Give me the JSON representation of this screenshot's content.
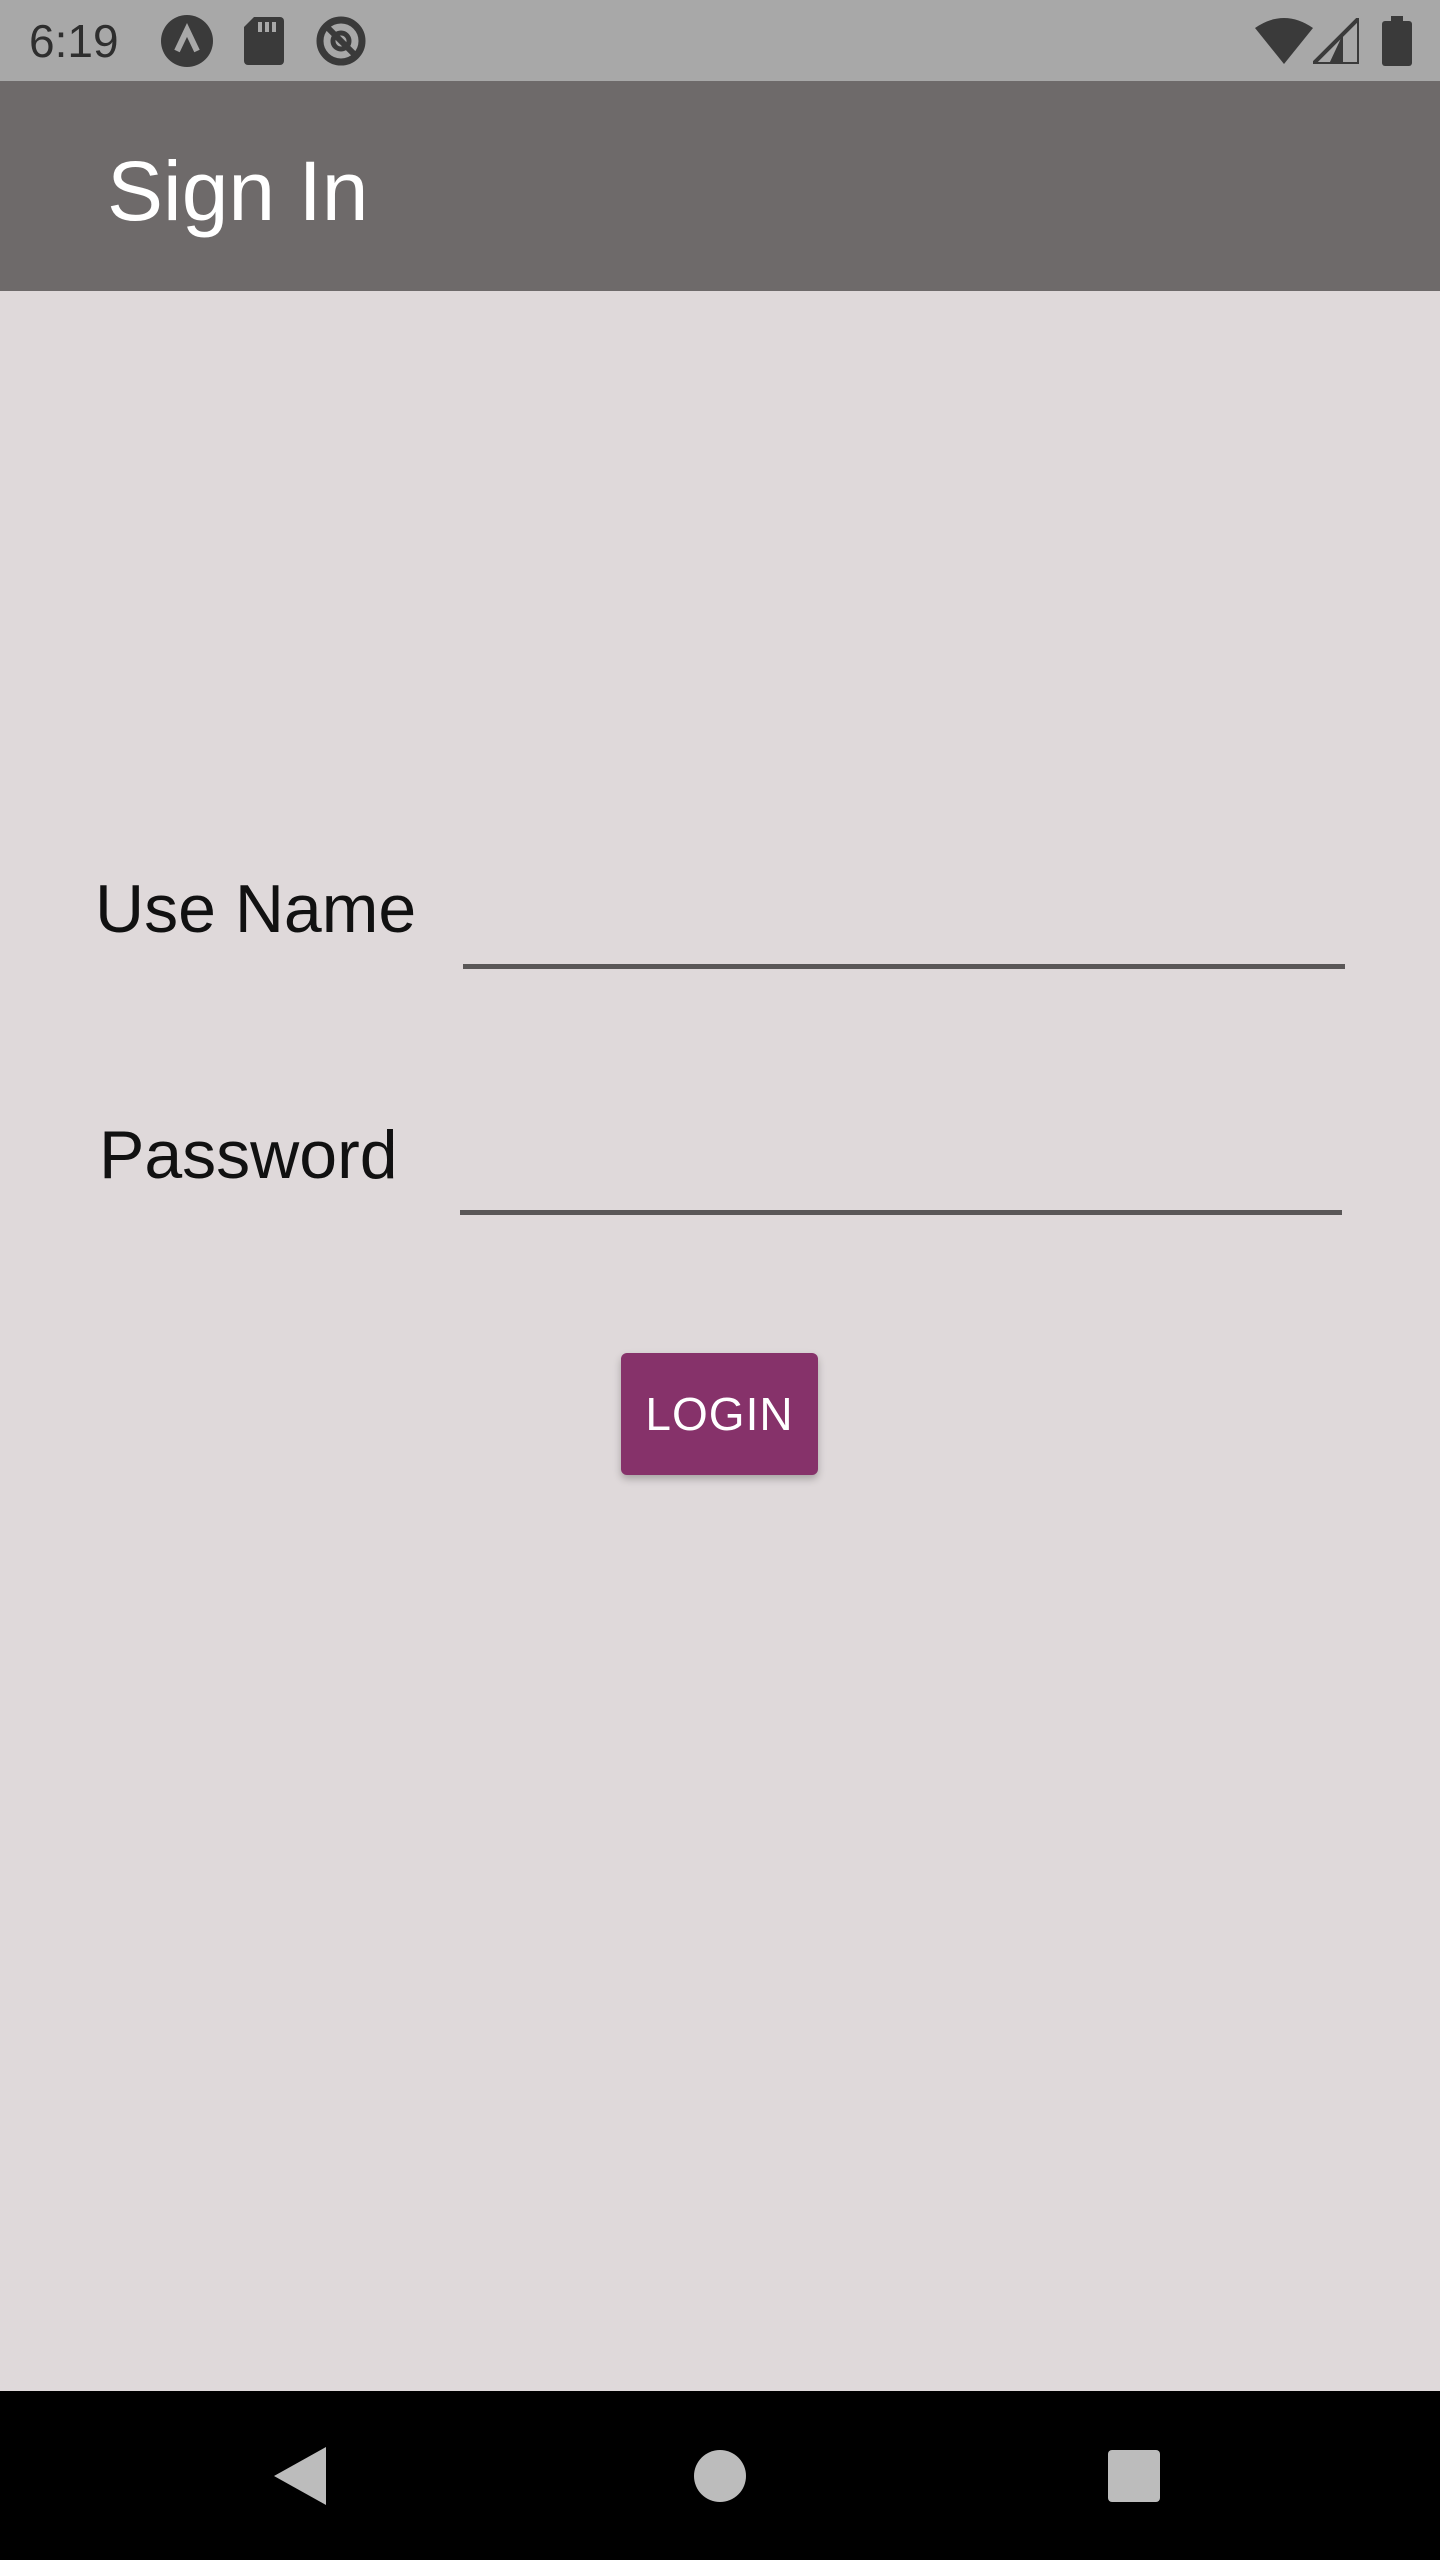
{
  "status_bar": {
    "time": "6:19",
    "left_icons": [
      "app-logo-icon",
      "sd-card-icon",
      "no-sync-icon"
    ],
    "right_icons": [
      "wifi-icon",
      "cellular-signal-icon",
      "battery-icon"
    ],
    "background": "#a8a8a8"
  },
  "app_bar": {
    "title": "Sign In",
    "background": "#6e6a6a"
  },
  "form": {
    "username_label": "Use Name",
    "username_value": "",
    "password_label": "Password",
    "password_value": "",
    "login_label": "LOGIN",
    "login_color": "#86326a",
    "background": "#dfd9da"
  },
  "nav_bar": {
    "buttons": [
      "back-icon",
      "home-icon",
      "recents-icon"
    ]
  }
}
